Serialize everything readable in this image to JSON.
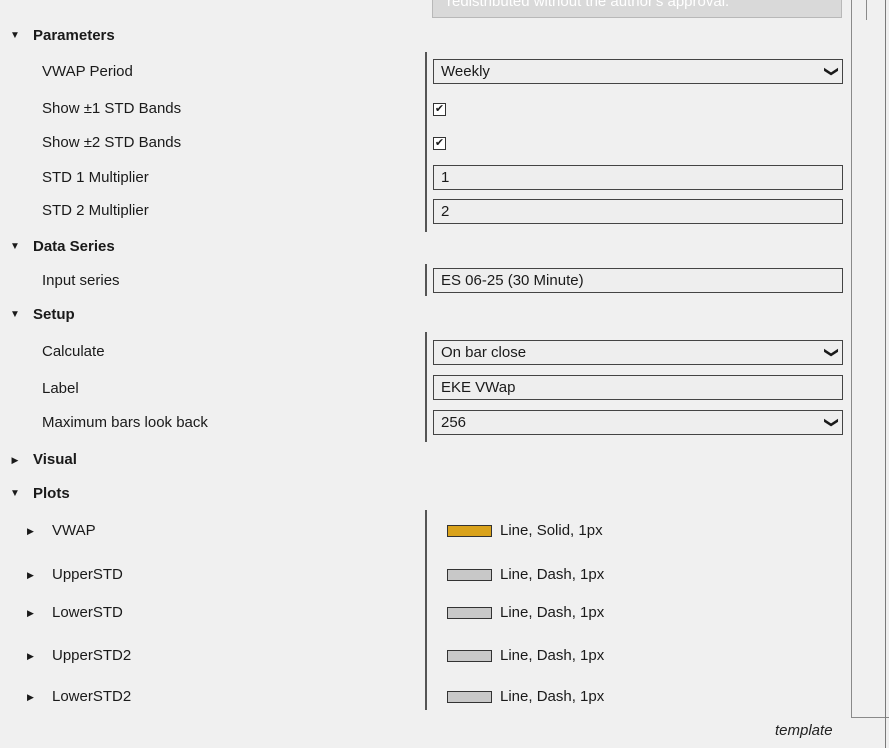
{
  "header_note": "redistributed without the author's approval.",
  "categories": {
    "parameters": "Parameters",
    "data_series": "Data Series",
    "setup": "Setup",
    "visual": "Visual",
    "plots": "Plots"
  },
  "parameters": {
    "vwap_period": {
      "label": "VWAP Period",
      "value": "Weekly"
    },
    "show_std1": {
      "label": "Show ±1 STD Bands",
      "checked": true
    },
    "show_std2": {
      "label": "Show ±2 STD Bands",
      "checked": true
    },
    "std1_multiplier": {
      "label": "STD 1 Multiplier",
      "value": "1"
    },
    "std2_multiplier": {
      "label": "STD 2 Multiplier",
      "value": "2"
    }
  },
  "data_series": {
    "input_series": {
      "label": "Input series",
      "value": "ES 06-25 (30 Minute)"
    }
  },
  "setup": {
    "calculate": {
      "label": "Calculate",
      "value": "On bar close"
    },
    "label": {
      "label": "Label",
      "value": "EKE VWap"
    },
    "max_bars": {
      "label": "Maximum bars look back",
      "value": "256"
    }
  },
  "plots": [
    {
      "name": "VWAP",
      "desc": "Line, Solid, 1px",
      "color": "#d9a21b"
    },
    {
      "name": "UpperSTD",
      "desc": "Line, Dash, 1px",
      "color": "#c8c8c8"
    },
    {
      "name": "LowerSTD",
      "desc": "Line, Dash, 1px",
      "color": "#c8c8c8"
    },
    {
      "name": "UpperSTD2",
      "desc": "Line, Dash, 1px",
      "color": "#c8c8c8"
    },
    {
      "name": "LowerSTD2",
      "desc": "Line, Dash, 1px",
      "color": "#c8c8c8"
    }
  ],
  "check_glyph": "✔",
  "expanded_glyph": "▼",
  "collapsed_glyph": "▶",
  "chevron_glyph": "❯",
  "footer_label": "template"
}
